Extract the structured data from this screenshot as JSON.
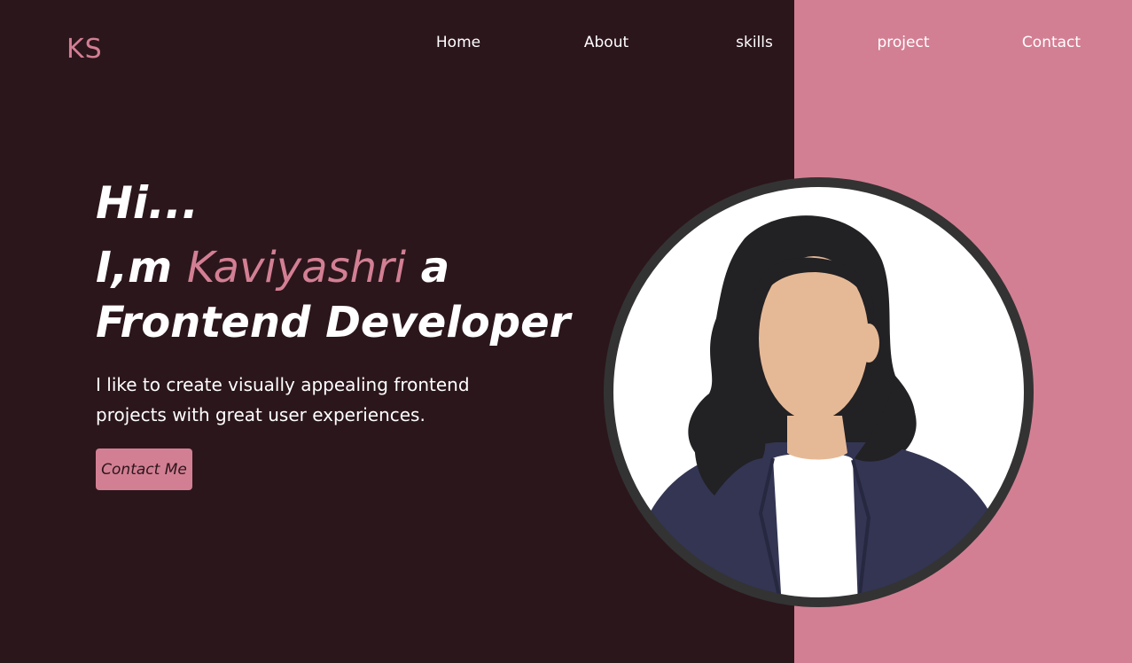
{
  "logo": "KS",
  "nav": {
    "items": [
      "Home",
      "About",
      "skills",
      "project",
      "Contact"
    ]
  },
  "hero": {
    "greeting": "Hi...",
    "intro_prefix": "I,m ",
    "name": "Kaviyashri",
    "intro_suffix": " a",
    "role": "Frontend Developer",
    "description": "I like to create visually appealing frontend projects with great user experiences.",
    "cta_label": "Contact Me"
  },
  "colors": {
    "background": "#2b161c",
    "accent": "#d37f93",
    "text": "#ffffff",
    "avatar_ring": "#333333"
  },
  "icons": {
    "avatar": "woman-illustration-icon"
  }
}
